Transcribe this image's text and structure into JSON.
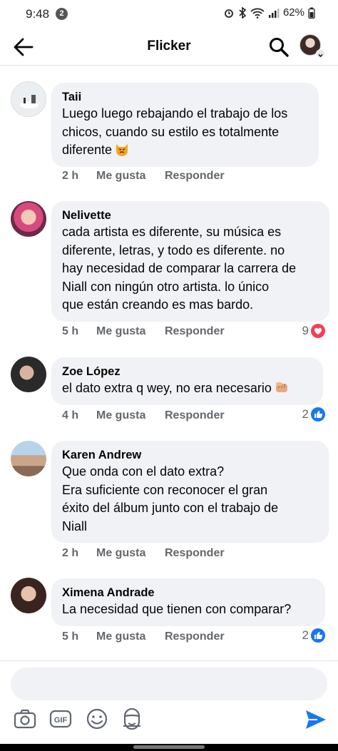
{
  "status_bar": {
    "time": "9:48",
    "notification_count": "2",
    "battery": "62%"
  },
  "header": {
    "title": "Flicker"
  },
  "actions_labels": {
    "like": "Me gusta",
    "reply": "Responder"
  },
  "comments": [
    {
      "name": "Taii",
      "text": "Luego luego rebajando el trabajo de los\nchicos, cuando su estilo es totalmente\ndiferente",
      "emoji": "pouting-cat",
      "time": "2 h",
      "reaction_count": "",
      "reaction_type": ""
    },
    {
      "name": "Nelivette",
      "text": "cada artista es diferente, su música es\ndiferente, letras, y todo es diferente. no\nhay necesidad de comparar la carrera de\nNiall con ningún otro artista. lo único\nque están creando es mas bardo.",
      "emoji": "",
      "time": "5 h",
      "reaction_count": "9",
      "reaction_type": "love"
    },
    {
      "name": "Zoe López",
      "text": "el dato extra q wey, no era necesario",
      "emoji": "fist",
      "time": "4 h",
      "reaction_count": "2",
      "reaction_type": "like"
    },
    {
      "name": "Karen Andrew",
      "text": "Que onda con el dato extra?\nEra suficiente con reconocer el gran\néxito del álbum junto con el trabajo de\nNiall",
      "emoji": "",
      "time": "2 h",
      "reaction_count": "",
      "reaction_type": ""
    },
    {
      "name": "Ximena Andrade",
      "text": "La necesidad que tienen con comparar?",
      "emoji": "",
      "time": "5 h",
      "reaction_count": "2",
      "reaction_type": "like"
    }
  ],
  "composer": {
    "placeholder": "",
    "tools": [
      "camera-icon",
      "gif-icon",
      "sticker-icon",
      "avatar-sticker-icon",
      "send-icon"
    ]
  },
  "colors": {
    "accent": "#1877f2",
    "love": "#f33e58",
    "bubble": "#f0f2f5",
    "secondary_text": "#65676b"
  }
}
